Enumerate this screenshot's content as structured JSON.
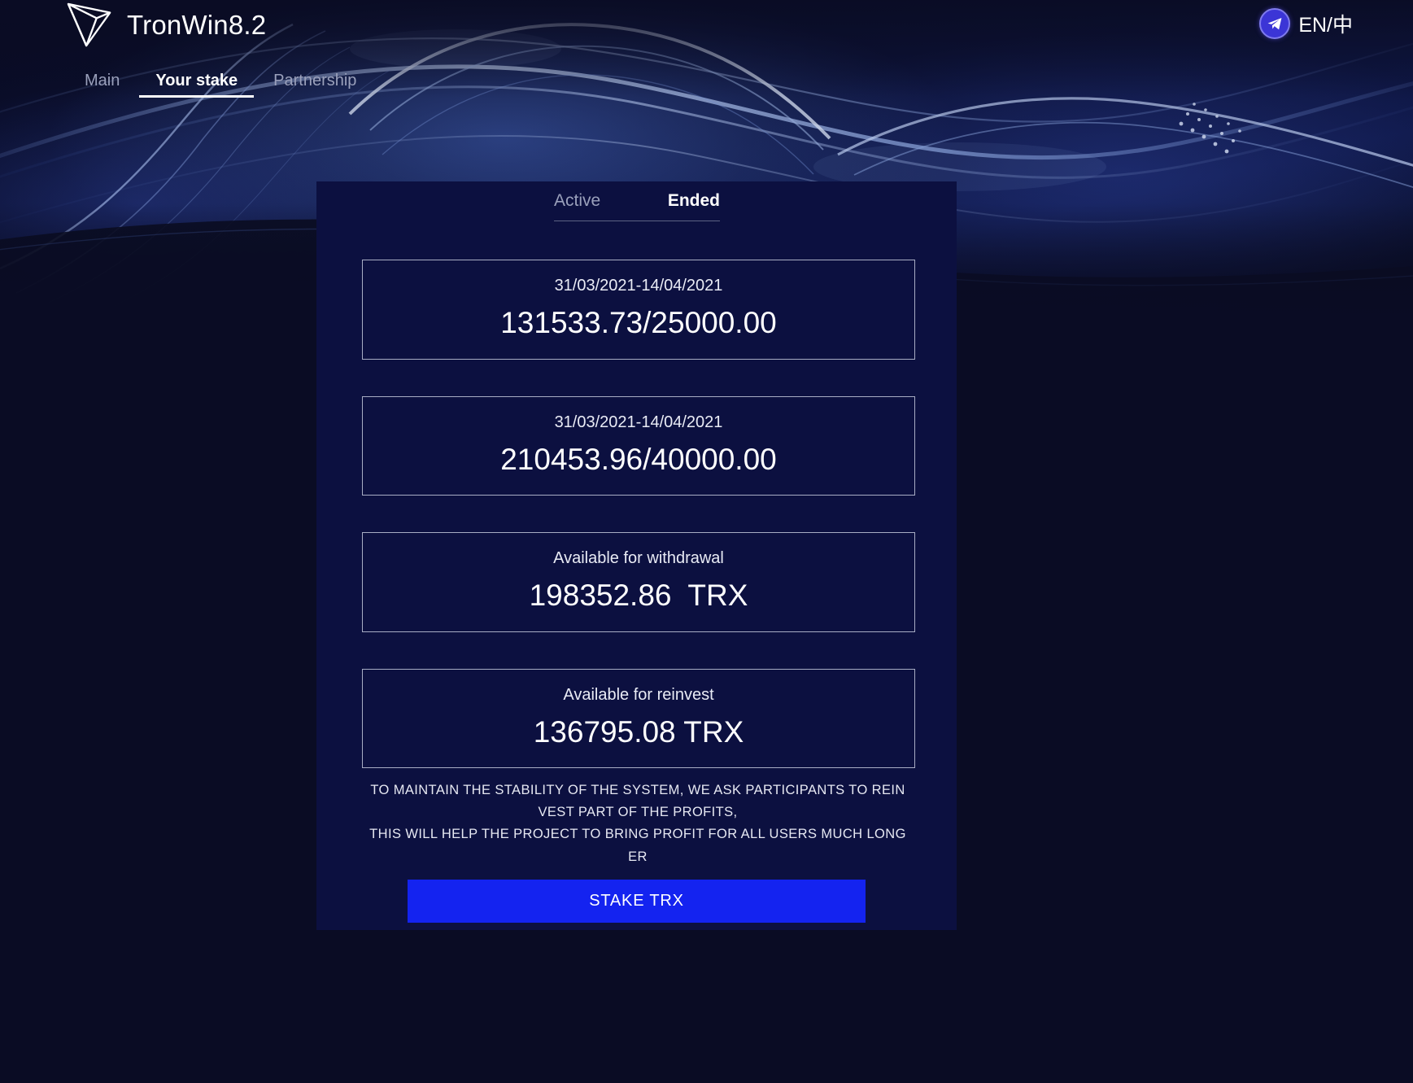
{
  "brand": {
    "title": "TronWin8.2",
    "logo_icon": "tron-logo-icon"
  },
  "nav": {
    "items": [
      {
        "label": "Main",
        "active": false
      },
      {
        "label": "Your stake",
        "active": true
      },
      {
        "label": "Partnership",
        "active": false
      }
    ]
  },
  "header_right": {
    "telegram_icon": "telegram-icon",
    "language": "EN/中"
  },
  "panel": {
    "tabs": [
      {
        "label": "Active",
        "active": false
      },
      {
        "label": "Ended",
        "active": true
      }
    ],
    "cards": [
      {
        "label": "31/03/2021-14/04/2021",
        "value": "131533.73/25000.00"
      },
      {
        "label": "31/03/2021-14/04/2021",
        "value": "210453.96/40000.00"
      },
      {
        "label": "Available for withdrawal",
        "value": "198352.86  TRX"
      },
      {
        "label": "Available for reinvest",
        "value": "136795.08 TRX"
      }
    ],
    "disclaimer_line1": "TO MAINTAIN THE STABILITY OF THE SYSTEM, WE ASK PARTICIPANTS TO REIN",
    "disclaimer_line2": "VEST PART OF THE PROFITS,",
    "disclaimer_line3": "THIS WILL HELP THE PROJECT TO BRING PROFIT FOR ALL USERS MUCH LONG",
    "disclaimer_line4": "ER",
    "stake_button": "STAKE TRX"
  },
  "colors": {
    "page_background": "#0a0c24",
    "panel_background": "#0c1040",
    "accent_button": "#1423f0",
    "card_border": "#a8adc4",
    "muted_text": "#9aa0bb",
    "telegram_blue": "#3b35d6"
  }
}
